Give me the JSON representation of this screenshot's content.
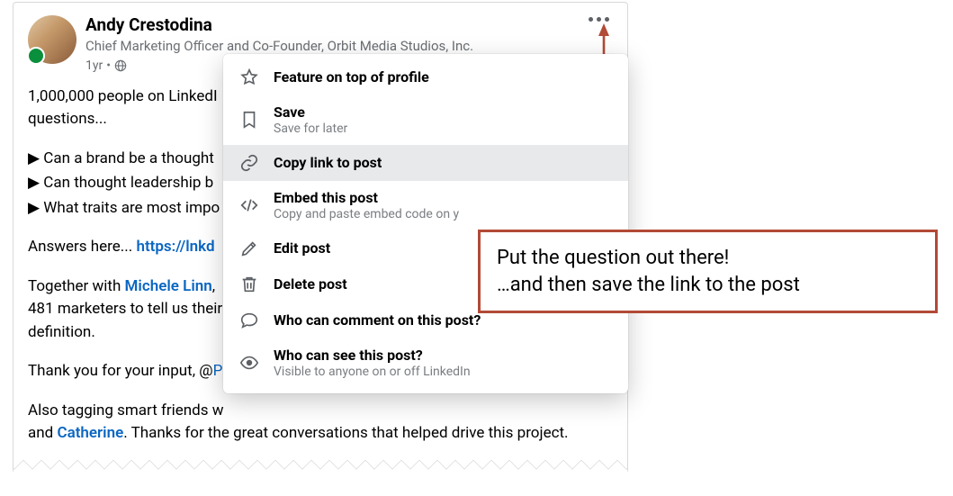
{
  "post": {
    "author": "Andy Crestodina",
    "headline": "Chief Marketing Officer and Co-Founder, Orbit Media Studios, Inc.",
    "age": "1yr",
    "visibility": "public",
    "line1_a": "1,000,000 people on LinkedI",
    "line1_b": "questions...",
    "bullets": [
      "Can a brand be a thought",
      "Can thought leadership b",
      "What traits are most impo"
    ],
    "answers_label": "Answers here... ",
    "answers_url": "https://lnkd",
    "together_a": "Together with ",
    "together_link": "Michele Linn",
    "together_b": ",",
    "together_c": "481 marketers to tell us their",
    "together_d": "definition.",
    "thanks_a": "Thank you for your input, @",
    "tag_a": "Also tagging smart friends w",
    "tag_b": "and ",
    "tag_link": "Catherine",
    "tag_c": ". Thanks for the great conversations that helped drive this project."
  },
  "menu": {
    "items": [
      {
        "label": "Feature on top of profile"
      },
      {
        "label": "Save",
        "sub": "Save for later"
      },
      {
        "label": "Copy link to post"
      },
      {
        "label": "Embed this post",
        "sub": "Copy and paste embed code on y"
      },
      {
        "label": "Edit post"
      },
      {
        "label": "Delete post"
      },
      {
        "label": "Who can comment on this post?"
      },
      {
        "label": "Who can see this post?",
        "sub": "Visible to anyone on or off LinkedIn"
      }
    ]
  },
  "callout": {
    "line1": "Put the question out there!",
    "line2": "…and then save the link to the post"
  }
}
